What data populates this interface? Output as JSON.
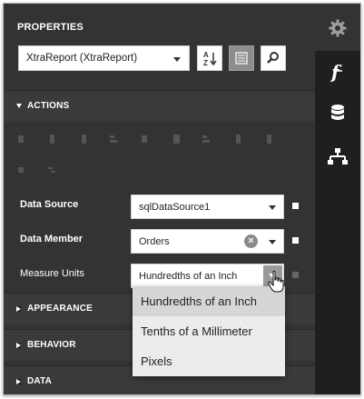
{
  "panel": {
    "title": "PROPERTIES",
    "component_selector": {
      "value": "XtraReport (XtraReport)"
    },
    "toolbar": [
      {
        "name": "sort-alphabetically-icon",
        "selected": false
      },
      {
        "name": "categorized-view-icon",
        "selected": true
      },
      {
        "name": "search-icon",
        "selected": false
      }
    ]
  },
  "sections": {
    "actions": "ACTIONS",
    "appearance": "APPEARANCE",
    "behavior": "BEHAVIOR",
    "data": "DATA"
  },
  "properties": [
    {
      "label": "Data Source",
      "value": "sqlDataSource1",
      "bold": true
    },
    {
      "label": "Data Member",
      "value": "Orders",
      "bold": true
    },
    {
      "label": "Measure Units",
      "value": "Hundredths of an Inch",
      "bold": false
    }
  ],
  "measure_units_options": [
    "Hundredths of an Inch",
    "Tenths of a Millimeter",
    "Pixels"
  ],
  "side_tabs": [
    "gear-icon",
    "function-icon",
    "database-icon",
    "hierarchy-icon"
  ],
  "colors": {
    "panel_bg": "#333333",
    "sidebar_bg": "#1f1f1f",
    "section_bg": "#3a3a3a",
    "text": "#ffffff"
  }
}
